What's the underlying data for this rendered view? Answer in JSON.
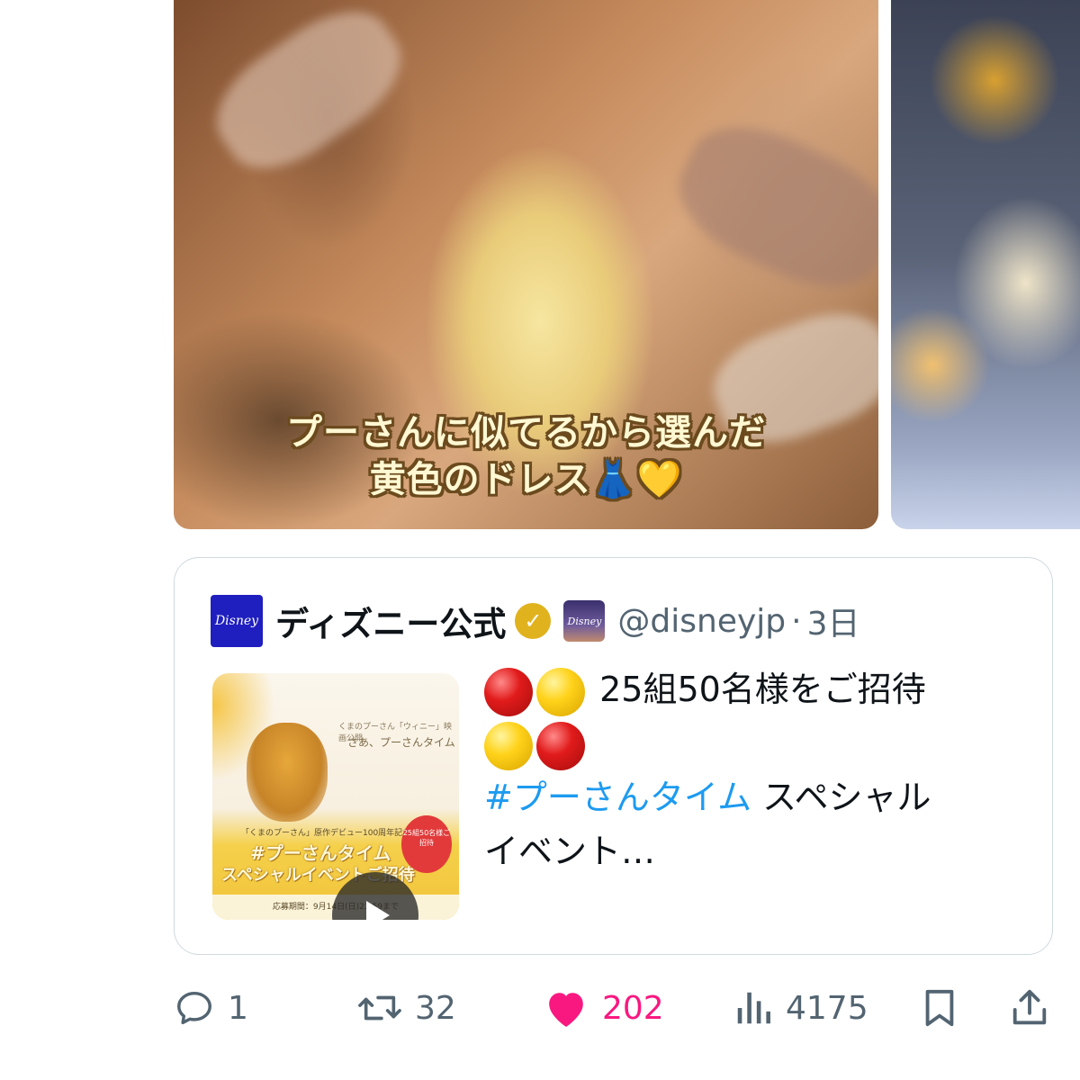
{
  "media": {
    "caption_line1": "プーさんに似てるから選んだ",
    "caption_line2": "黄色のドレス👗💛"
  },
  "quote": {
    "account_name": "ディズニー公式",
    "avatar_text": "Disney",
    "affiliate_text": "Disney",
    "handle": "@disneyjp",
    "separator": "·",
    "time": "3日",
    "text_line1": "25組50名様をご招待",
    "hashtag": "#プーさんタイム",
    "text_after_hashtag": " スペシャル",
    "text_line4": "イベント…",
    "thumbnail": {
      "sub_text": "くまのプーさん「ウィニー」映画公開",
      "title": "さあ、プーさんタイム",
      "small_text": "「くまのプーさん」原作デビュー100周年記念",
      "big_line1": "#プーさんタイム",
      "big_line2": "スペシャルイベントご招待",
      "balloon": "25組50名様ご招待",
      "footer": "応募期間：9月14日(日)23:59まで"
    }
  },
  "actions": {
    "reply_count": "1",
    "retweet_count": "32",
    "like_count": "202",
    "views_count": "4175"
  },
  "colors": {
    "like": "#f91880",
    "hashtag": "#1d9bf0",
    "secondary_text": "#536471",
    "verified": "#e0b21e"
  }
}
